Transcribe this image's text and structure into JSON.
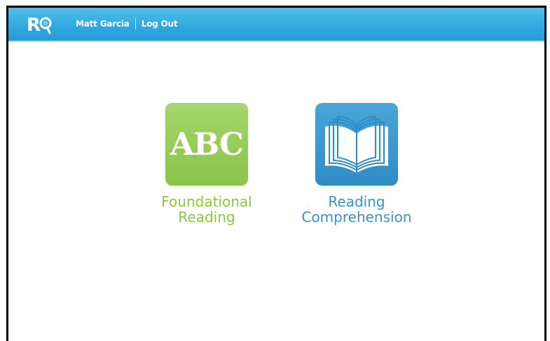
{
  "header": {
    "user_name": "Matt Garcia",
    "logout_label": "Log Out",
    "colors": {
      "bar": "#2fa6de",
      "text": "#ffffff"
    }
  },
  "tiles": [
    {
      "id": "foundational-reading",
      "icon_text": "ABC",
      "label_line1": "Foundational",
      "label_line2": "Reading",
      "icon": "abc-icon",
      "color": "#8cc63f"
    },
    {
      "id": "reading-comprehension",
      "label_line1": "Reading",
      "label_line2": "Comprehension",
      "icon": "open-book-icon",
      "color": "#3a92c8"
    }
  ]
}
